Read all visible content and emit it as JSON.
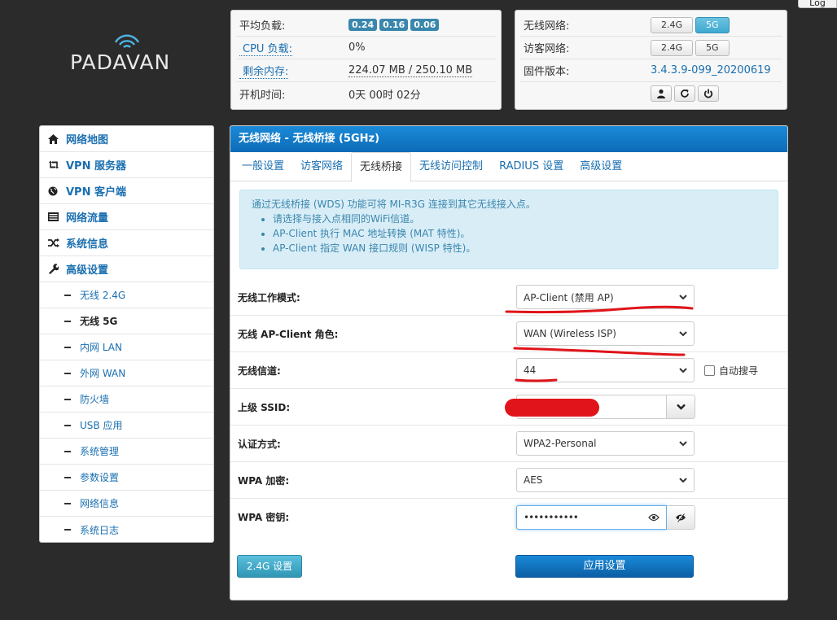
{
  "top_bar": {
    "log_label": "Log"
  },
  "logo": {
    "text": "PADAVAN"
  },
  "status": {
    "load_label": "平均负载:",
    "load_values": [
      "0.24",
      "0.16",
      "0.06"
    ],
    "cpu_label": "CPU 负载:",
    "cpu_value": "0%",
    "mem_label": "剩余内存:",
    "mem_value": "224.07 MB / 250.10 MB",
    "uptime_label": "开机时间:",
    "uptime_value": "0天 00时 02分"
  },
  "wifi_status": {
    "wireless_label": "无线网络:",
    "guest_label": "访客网络:",
    "firmware_label": "固件版本:",
    "btn_24g": "2.4G",
    "btn_5g": "5G",
    "firmware_value": "3.4.3.9-099_20200619",
    "icons": [
      "user-icon",
      "refresh-icon",
      "power-icon"
    ]
  },
  "sidebar": {
    "items": [
      {
        "label": "网络地图",
        "icon": "home-icon"
      },
      {
        "label": "VPN 服务器",
        "icon": "retweet-icon"
      },
      {
        "label": "VPN 客户端",
        "icon": "globe-icon"
      },
      {
        "label": "网络流量",
        "icon": "list-icon"
      },
      {
        "label": "系统信息",
        "icon": "random-icon"
      },
      {
        "label": "高级设置",
        "icon": "wrench-icon"
      }
    ],
    "sub_items": [
      {
        "label": "无线 2.4G"
      },
      {
        "label": "无线 5G",
        "active": true
      },
      {
        "label": "内网 LAN"
      },
      {
        "label": "外网 WAN"
      },
      {
        "label": "防火墙"
      },
      {
        "label": "USB 应用"
      },
      {
        "label": "系统管理"
      },
      {
        "label": "参数设置"
      },
      {
        "label": "网络信息"
      },
      {
        "label": "系统日志"
      }
    ]
  },
  "main": {
    "title": "无线网络 - 无线桥接 (5GHz)",
    "tabs": [
      {
        "label": "一般设置"
      },
      {
        "label": "访客网络"
      },
      {
        "label": "无线桥接",
        "active": true
      },
      {
        "label": "无线访问控制"
      },
      {
        "label": "RADIUS 设置"
      },
      {
        "label": "高级设置"
      }
    ],
    "info": {
      "intro": "通过无线桥接 (WDS) 功能可将 MI-R3G 连接到其它无线接入点。",
      "bullets": [
        "请选择与接入点相同的WiFi信道。",
        "AP-Client 执行 MAC 地址转换 (MAT 特性)。",
        "AP-Client 指定 WAN 接口规则 (WISP 特性)。"
      ]
    },
    "form": {
      "mode_label": "无线工作模式:",
      "mode_value": "AP-Client (禁用 AP)",
      "role_label": "无线 AP-Client 角色:",
      "role_value": "WAN (Wireless ISP)",
      "channel_label": "无线信道:",
      "channel_value": "44",
      "auto_scan_label": "自动搜寻",
      "ssid_label": "上级 SSID:",
      "ssid_value": "",
      "auth_label": "认证方式:",
      "auth_value": "WPA2-Personal",
      "enc_label": "WPA 加密:",
      "enc_value": "AES",
      "key_label": "WPA 密钥:",
      "key_value": "•••••••••••"
    },
    "buttons": {
      "secondary": "2.4G 设置",
      "primary": "应用设置"
    }
  },
  "colors": {
    "brand_blue": "#0d6bb8",
    "badge": "#3a87ad",
    "annotation_red": "#e0141a"
  }
}
